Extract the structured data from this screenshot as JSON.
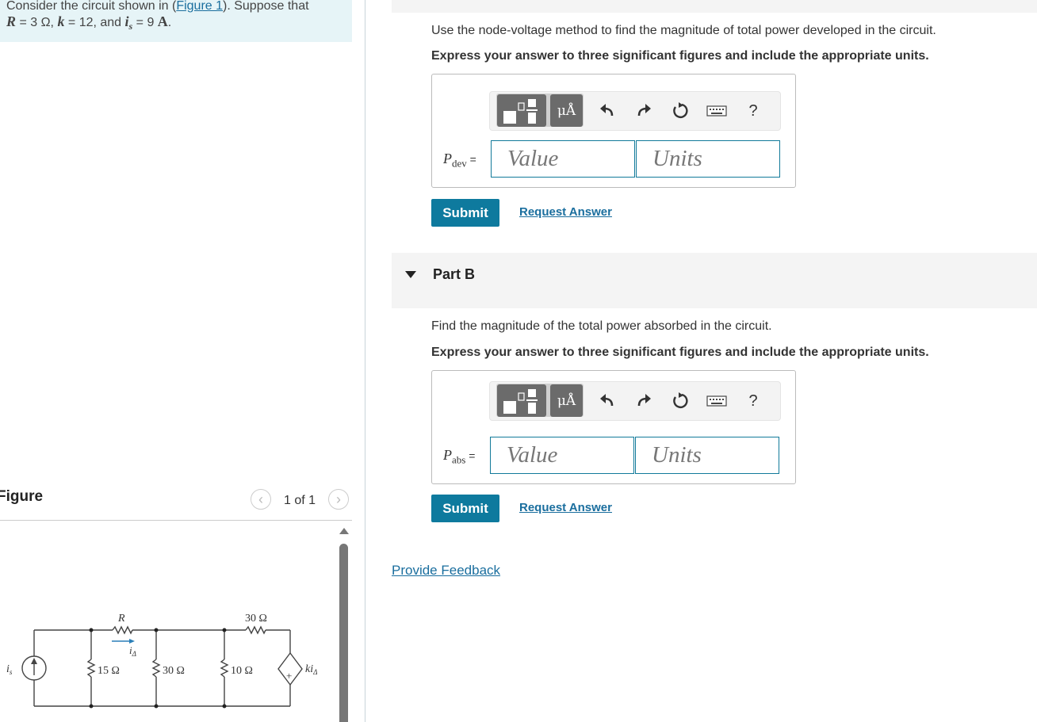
{
  "problem": {
    "line1_pre": "Consider the circuit shown in (",
    "figure_link": "Figure 1",
    "line1_post": "). Suppose that",
    "R_sym": "R",
    "R_val": " = 3 Ω, ",
    "k_sym": "k",
    "k_val": " = 12, and ",
    "is_sym": "i",
    "is_sub": "s",
    "is_val": " = 9 ",
    "amp": "A",
    "period": "."
  },
  "figure": {
    "title": "Figure",
    "pager": "1 of 1",
    "circuit_labels": {
      "R": "R",
      "r30top": "30 Ω",
      "ia": "i",
      "ia_sub": "Δ",
      "is": "i",
      "is_sub": "s",
      "r15": "15 Ω",
      "r30": "30 Ω",
      "r10": "10 Ω",
      "kia": "ki",
      "kia_sub": "Δ",
      "plus": "+"
    }
  },
  "partA": {
    "instruction": "Use the node-voltage method to find the magnitude of total power developed in the circuit.",
    "format": "Express your answer to three significant figures and include the appropriate units.",
    "label_sym": "P",
    "label_sub": "dev",
    "label_eq": " =",
    "value_placeholder": "Value",
    "units_placeholder": "Units",
    "submit": "Submit",
    "request": "Request Answer"
  },
  "partB": {
    "title": "Part B",
    "instruction": "Find the magnitude of the total power absorbed in the circuit.",
    "format": "Express your answer to three significant figures and include the appropriate units.",
    "label_sym": "P",
    "label_sub": "abs",
    "label_eq": " =",
    "value_placeholder": "Value",
    "units_placeholder": "Units",
    "submit": "Submit",
    "request": "Request Answer"
  },
  "toolbar": {
    "units_button": "μÅ",
    "help": "?",
    "icons": [
      "templates-icon",
      "units-icon",
      "undo-icon",
      "redo-icon",
      "reset-icon",
      "keyboard-icon",
      "help-icon"
    ]
  },
  "feedback": "Provide Feedback",
  "colors": {
    "accent": "#0e7a9e",
    "link": "#1a6e9e",
    "intro_bg": "#e6f4f7"
  }
}
